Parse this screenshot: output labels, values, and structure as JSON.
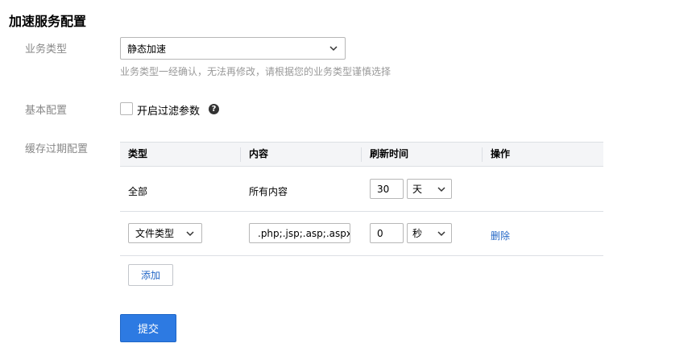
{
  "page": {
    "title": "加速服务配置"
  },
  "business_type": {
    "label": "业务类型",
    "selected": "静态加速",
    "hint": "业务类型一经确认，无法再修改，请根据您的业务类型谨慎选择"
  },
  "basic_config": {
    "label": "基本配置",
    "checkbox_label": "开启过滤参数",
    "checked": false,
    "help_icon": "question-circle-icon"
  },
  "cache_config": {
    "label": "缓存过期配置",
    "columns": [
      "类型",
      "内容",
      "刷新时间",
      "操作"
    ],
    "rows": [
      {
        "type": "全部",
        "content": "所有内容",
        "time_value": "30",
        "time_unit": "天",
        "action": ""
      },
      {
        "type": "文件类型",
        "content": ".php;.jsp;.asp;.aspx",
        "time_value": "0",
        "time_unit": "秒",
        "action": "删除"
      }
    ],
    "add_label": "添加"
  },
  "submit_label": "提交",
  "colors": {
    "primary": "#2d7ae2",
    "link": "#2467c6",
    "hint": "#999999",
    "label": "#888888"
  }
}
